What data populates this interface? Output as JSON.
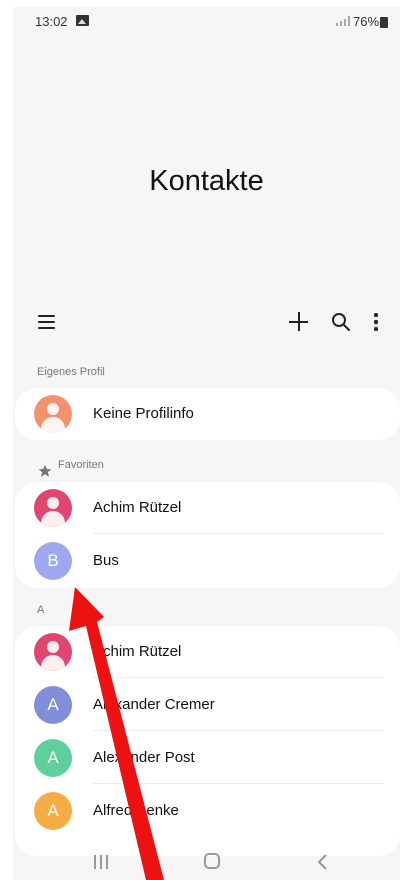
{
  "status": {
    "time": "13:02",
    "battery": "76%",
    "image_icon": "gallery-icon",
    "signal_icon": "signal-icon",
    "battery_icon": "battery-icon"
  },
  "header": {
    "title": "Kontakte"
  },
  "toolbar": {
    "menu_icon": "menu-icon",
    "add_icon": "add-icon",
    "search_icon": "search-icon",
    "more_icon": "more-options-icon"
  },
  "sections": {
    "profile_label": "Eigenes Profil",
    "favorites_label": "Favoriten",
    "a_label": "A"
  },
  "profile": {
    "name": "Keine Profilinfo",
    "avatar_color": "#f4926f"
  },
  "favorites": [
    {
      "name": "Achim Rützel",
      "initial": "",
      "avatar_color": "#e0466f"
    },
    {
      "name": "Bus",
      "initial": "B",
      "avatar_color": "#9fa7ee"
    }
  ],
  "contacts_a": [
    {
      "name": "Achim Rützel",
      "initial": "",
      "avatar_color": "#e0466f"
    },
    {
      "name": "Alexander Cremer",
      "initial": "A",
      "avatar_color": "#7f8fd8"
    },
    {
      "name": "Alexander Post",
      "initial": "A",
      "avatar_color": "#5fcf9c"
    },
    {
      "name": "Alfred Benke",
      "initial": "A",
      "avatar_color": "#f5ac45"
    }
  ],
  "navbar": {
    "recents_icon": "recents-icon",
    "home_icon": "home-icon",
    "back_icon": "back-icon"
  },
  "annotation": {
    "arrow_color": "#ee1111"
  }
}
